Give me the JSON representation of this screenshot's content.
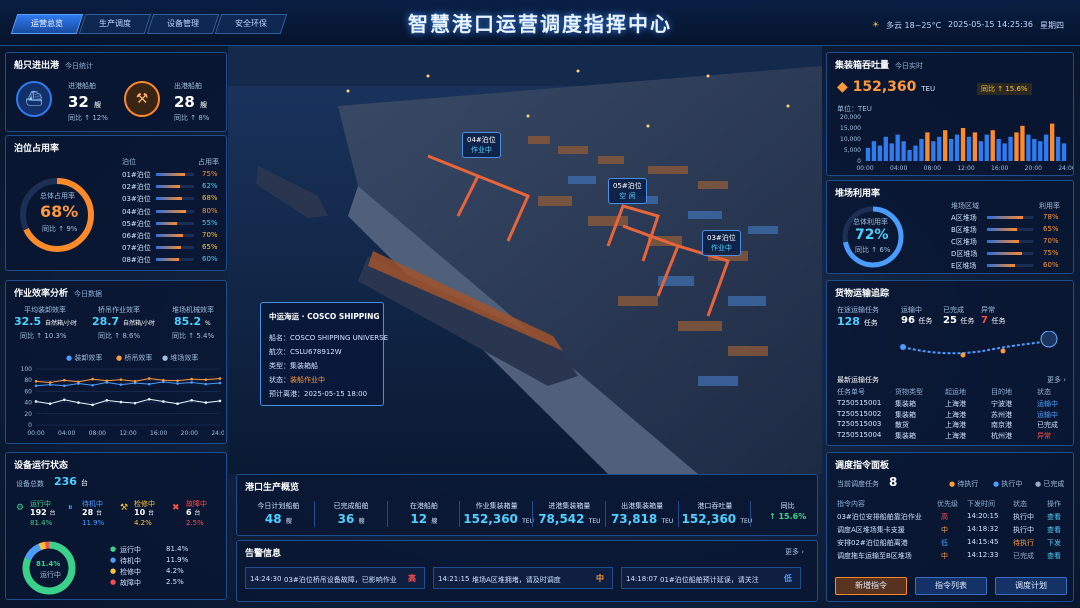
{
  "nav": {
    "tabs": [
      "运营总览",
      "生产调度",
      "设备管理",
      "安全环保"
    ]
  },
  "title": "智慧港口运营调度指挥中心",
  "header": {
    "weather": "多云 18~25°C",
    "datetime": "2025-05-15 14:25:36",
    "weekday": "星期四"
  },
  "ships": {
    "title": "船只进出港",
    "sub": "今日统计",
    "in_label": "进港船舶",
    "in_value": "32",
    "in_unit": "艘",
    "in_change": "同比 ↑ 12%",
    "out_label": "出港船舶",
    "out_value": "28",
    "out_unit": "艘",
    "out_change": "同比 ↑ 8%"
  },
  "berth": {
    "title": "泊位占用率",
    "col1": "泊位",
    "col2": "占用率",
    "ring_label": "总体占用率",
    "ring_value": "68%",
    "ring_pct": 68,
    "ring_change": "同比 ↑ 9%",
    "rows": [
      {
        "name": "01#泊位",
        "rate": "75%",
        "pct": 75
      },
      {
        "name": "02#泊位",
        "rate": "62%",
        "pct": 62
      },
      {
        "name": "03#泊位",
        "rate": "68%",
        "pct": 68
      },
      {
        "name": "04#泊位",
        "rate": "80%",
        "pct": 80
      },
      {
        "name": "05#泊位",
        "rate": "55%",
        "pct": 55
      },
      {
        "name": "06#泊位",
        "rate": "70%",
        "pct": 70
      },
      {
        "name": "07#泊位",
        "rate": "65%",
        "pct": 65
      },
      {
        "name": "08#泊位",
        "rate": "60%",
        "pct": 60
      }
    ]
  },
  "eff": {
    "title": "作业效率分析",
    "sub": "今日数据",
    "m1_label": "平均装卸效率",
    "m1_value": "32.5",
    "m1_unit": "自然箱/小时",
    "m1_change": "同比 ↑ 10.3%",
    "m2_label": "桥吊作业效率",
    "m2_value": "28.7",
    "m2_unit": "自然箱/小时",
    "m2_change": "同比 ↑ 8.6%",
    "m3_label": "堆场机械效率",
    "m3_value": "85.2",
    "m3_unit": "%",
    "m3_change": "同比 ↑ 5.4%",
    "legend": [
      "装卸效率",
      "桥吊效率",
      "堆场效率"
    ]
  },
  "eff_chart": {
    "type": "line",
    "x": [
      "00:00",
      "04:00",
      "08:00",
      "12:00",
      "16:00",
      "20:00",
      "24:00"
    ],
    "ylim": [
      0,
      100
    ],
    "yticks": [
      "100",
      "80",
      "60",
      "40",
      "20",
      "0"
    ],
    "series": [
      {
        "name": "装卸效率",
        "color": "#4a9dff",
        "values": [
          70,
          72,
          70,
          74,
          71,
          76,
          72,
          75,
          73,
          77,
          74,
          76,
          73,
          75
        ]
      },
      {
        "name": "桥吊效率",
        "color": "#ff9a3c",
        "values": [
          78,
          76,
          80,
          77,
          82,
          79,
          81,
          78,
          83,
          80,
          79,
          82,
          81,
          83
        ]
      },
      {
        "name": "堆场效率",
        "color": "#e8f3ff",
        "values": [
          42,
          38,
          45,
          40,
          36,
          44,
          41,
          39,
          46,
          42,
          38,
          44,
          40,
          43
        ]
      }
    ]
  },
  "equip": {
    "title": "设备运行状态",
    "total_label": "设备总数",
    "total_value": "236",
    "total_unit": "台",
    "stats": [
      {
        "label": "运行中",
        "value": "192",
        "unit": "台",
        "pct": "81.4%"
      },
      {
        "label": "待机中",
        "value": "28",
        "unit": "台",
        "pct": "11.9%"
      },
      {
        "label": "检修中",
        "value": "10",
        "unit": "台",
        "pct": "4.2%"
      },
      {
        "label": "故障中",
        "value": "6",
        "unit": "台",
        "pct": "2.5%"
      }
    ],
    "ring_value": "81.4%",
    "ring_label": "运行中",
    "legend": [
      {
        "label": "运行中",
        "pct": "81.4%"
      },
      {
        "label": "待机中",
        "pct": "11.9%"
      },
      {
        "label": "检修中",
        "pct": "4.2%"
      },
      {
        "label": "故障中",
        "pct": "2.5%"
      }
    ]
  },
  "tags": {
    "b04": "04#泊位",
    "b04s": "作业中",
    "b05": "05#泊位",
    "b05s": "空 闲",
    "b03": "03#泊位",
    "b03s": "作业中"
  },
  "ship_card": {
    "company": "中运海运 · COSCO SHIPPING",
    "name_l": "船名：",
    "name_v": "COSCO SHIPPING UNIVERSE",
    "voy_l": "航次：",
    "voy_v": "CSLU678912W",
    "type_l": "类型：",
    "type_v": "集装箱船",
    "status_l": "状态：",
    "status_v": "装船作业中",
    "eta_l": "预计离港：",
    "eta_v": "2025-05-15 18:00"
  },
  "prod": {
    "title": "港口生产概览",
    "items": [
      {
        "label": "今日计划船舶",
        "value": "48",
        "unit": "艘"
      },
      {
        "label": "已完成船舶",
        "value": "36",
        "unit": "艘"
      },
      {
        "label": "在港船舶",
        "value": "12",
        "unit": "艘"
      },
      {
        "label": "作业集装箱量",
        "value": "152,360",
        "unit": "TEU"
      },
      {
        "label": "进港集装箱量",
        "value": "78,542",
        "unit": "TEU"
      },
      {
        "label": "出港集装箱量",
        "value": "73,818",
        "unit": "TEU"
      },
      {
        "label": "港口吞吐量",
        "value": "152,360",
        "unit": "TEU"
      },
      {
        "label": "同比",
        "value": "↑ 15.6%",
        "unit": ""
      }
    ]
  },
  "alert": {
    "title": "告警信息",
    "more": "更多 ›",
    "items": [
      {
        "time": "14:24:30",
        "text": "03#泊位桥吊设备故障，已影响作业",
        "level": "高"
      },
      {
        "time": "14:21:15",
        "text": "堆场A区堆拥堵，请及时调度",
        "level": "中"
      },
      {
        "time": "14:18:07",
        "text": "01#泊位船舶预计延误，请关注",
        "level": "低"
      }
    ]
  },
  "throughput": {
    "title": "集装箱吞吐量",
    "sub": "今日实时",
    "value": "152,360",
    "unit": "TEU",
    "change": "同比 ↑ 15.6%",
    "ylabel": "单位：TEU"
  },
  "tp_chart": {
    "type": "bar",
    "x": [
      "00:00",
      "04:00",
      "08:00",
      "12:00",
      "16:00",
      "20:00",
      "24:00"
    ],
    "yticks": [
      "20,000",
      "15,000",
      "10,000",
      "5,000",
      "0"
    ],
    "ylim": [
      0,
      20000
    ],
    "values": [
      6000,
      9000,
      7000,
      11000,
      8000,
      12000,
      9000,
      5000,
      7000,
      10000,
      13000,
      9000,
      11000,
      14000,
      10000,
      12000,
      15000,
      11000,
      13000,
      9000,
      12000,
      14000,
      10000,
      8000,
      11000,
      13000,
      16000,
      12000,
      10000,
      9000,
      12000,
      17000,
      11000,
      8000
    ]
  },
  "yard": {
    "title": "堆场利用率",
    "ring_label": "总体利用率",
    "ring_value": "72%",
    "ring_pct": 72,
    "ring_change": "同比 ↑ 6%",
    "col1": "堆场区域",
    "col2": "利用率",
    "rows": [
      {
        "name": "A区堆场",
        "rate": "78%",
        "pct": 78
      },
      {
        "name": "B区堆场",
        "rate": "65%",
        "pct": 65
      },
      {
        "name": "C区堆场",
        "rate": "70%",
        "pct": 70
      },
      {
        "name": "D区堆场",
        "rate": "75%",
        "pct": 75
      },
      {
        "name": "E区堆场",
        "rate": "60%",
        "pct": 60
      }
    ]
  },
  "cargo": {
    "title": "货物运输追踪",
    "s1_label": "在途运输任务",
    "s1_value": "128",
    "s1_unit": "任务",
    "s2_label": "运输中",
    "s2_value": "96",
    "s2_unit": "任务",
    "s3_label": "已完成",
    "s3_value": "25",
    "s3_unit": "任务",
    "s4_label": "异常",
    "s4_value": "7",
    "s4_unit": "任务",
    "list_title": "最新运输任务",
    "more": "更多 ›",
    "headers": [
      "任务单号",
      "货物类型",
      "起运地",
      "目的地",
      "状态"
    ],
    "rows": [
      {
        "id": "T250515001",
        "type": "集装箱",
        "from": "上海港",
        "to": "宁波港",
        "status": "运输中"
      },
      {
        "id": "T250515002",
        "type": "集装箱",
        "from": "上海港",
        "to": "苏州港",
        "status": "运输中"
      },
      {
        "id": "T250515003",
        "type": "散货",
        "from": "上海港",
        "to": "南京港",
        "status": "已完成"
      },
      {
        "id": "T250515004",
        "type": "集装箱",
        "from": "上海港",
        "to": "杭州港",
        "status": "异常"
      }
    ]
  },
  "dispatch": {
    "title": "调度指令面板",
    "pending_label": "当前调度任务",
    "pending_value": "8",
    "legend": [
      "待执行",
      "执行中",
      "已完成"
    ],
    "headers": [
      "指令内容",
      "优先级",
      "下发时间",
      "状态",
      "操作"
    ],
    "rows": [
      {
        "text": "03#泊位安排船舶靠泊作业",
        "pri": "高",
        "time": "14:20:15",
        "status": "执行中",
        "op": "查看"
      },
      {
        "text": "调度A区堆场集卡支援",
        "pri": "中",
        "time": "14:18:32",
        "status": "执行中",
        "op": "查看"
      },
      {
        "text": "安排02#泊位船舶离港",
        "pri": "低",
        "time": "14:15:45",
        "status": "待执行",
        "op": "下发"
      },
      {
        "text": "调度拖车运输至B区堆场",
        "pri": "中",
        "time": "14:12:33",
        "status": "已完成",
        "op": "查看"
      }
    ],
    "btn_new": "新增指令",
    "btn_list": "指令列表",
    "btn_plan": "调度计划"
  },
  "colors": {
    "accent": "#4a9dff",
    "orange": "#ff9a3c",
    "red": "#ff4d4d",
    "green": "#3ad28a"
  }
}
